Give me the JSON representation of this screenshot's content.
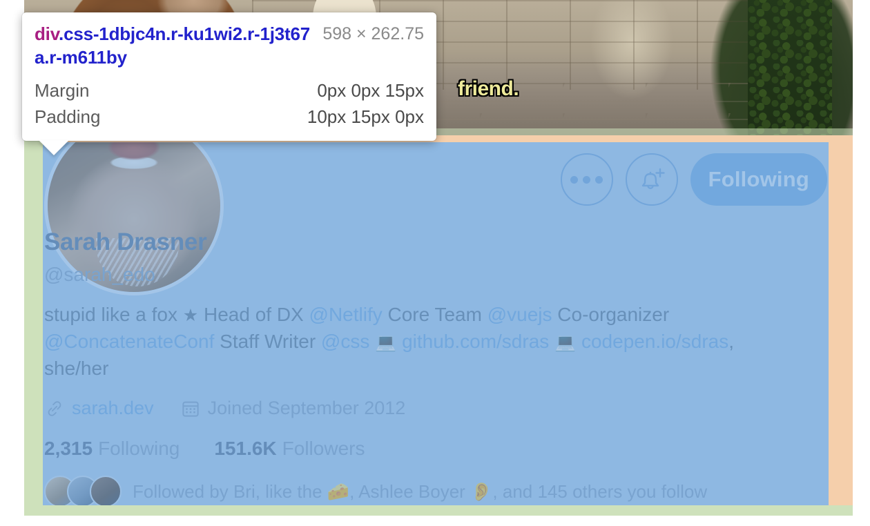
{
  "devtools_tooltip": {
    "tag": "div",
    "classes": ".css-1dbjc4n.r-ku1wi2.r-1j3t67a.r-m611by",
    "dimensions": "598 × 262.75",
    "rows": [
      {
        "key": "Margin",
        "value": "0px 0px 15px"
      },
      {
        "key": "Padding",
        "value": "10px 15px 0px"
      }
    ]
  },
  "highlight_colors": {
    "margin": "#cee1bb",
    "padding": "#f5cfab",
    "content": "#a9c9e9",
    "accent_blue": "#6aa7e0"
  },
  "banner": {
    "caption": "friend.",
    "alt": "person standing before a stone wall with a shaggy beast"
  },
  "profile": {
    "display_name": "Sarah Drasner",
    "handle": "@sarah_edo",
    "bio_parts": [
      {
        "type": "text",
        "text": "stupid like a fox "
      },
      {
        "type": "emoji",
        "text": "★"
      },
      {
        "type": "text",
        "text": " Head of DX "
      },
      {
        "type": "mention",
        "text": "@Netlify"
      },
      {
        "type": "text",
        "text": " Core Team "
      },
      {
        "type": "mention",
        "text": "@vuejs"
      },
      {
        "type": "text",
        "text": " Co-organizer "
      },
      {
        "type": "mention",
        "text": "@ConcatenateConf"
      },
      {
        "type": "text",
        "text": " Staff Writer "
      },
      {
        "type": "mention",
        "text": "@css"
      },
      {
        "type": "text",
        "text": " "
      },
      {
        "type": "emoji",
        "text": "💻"
      },
      {
        "type": "text",
        "text": " "
      },
      {
        "type": "mention",
        "text": "github.com/sdras"
      },
      {
        "type": "text",
        "text": " "
      },
      {
        "type": "emoji",
        "text": "💻"
      },
      {
        "type": "text",
        "text": " "
      },
      {
        "type": "mention",
        "text": "codepen.io/sdras"
      },
      {
        "type": "text",
        "text": ", she/her"
      }
    ],
    "website": "sarah.dev",
    "joined": "Joined September 2012",
    "following_count": "2,315",
    "following_label": "Following",
    "followers_count": "151.6K",
    "followers_label": "Followers",
    "followed_by": "Followed by Bri, like the 🧀, Ashlee Boyer 👂, and 145 others you follow",
    "actions": {
      "more_label": "More",
      "notify_label": "Notify",
      "follow_label": "Following"
    }
  }
}
